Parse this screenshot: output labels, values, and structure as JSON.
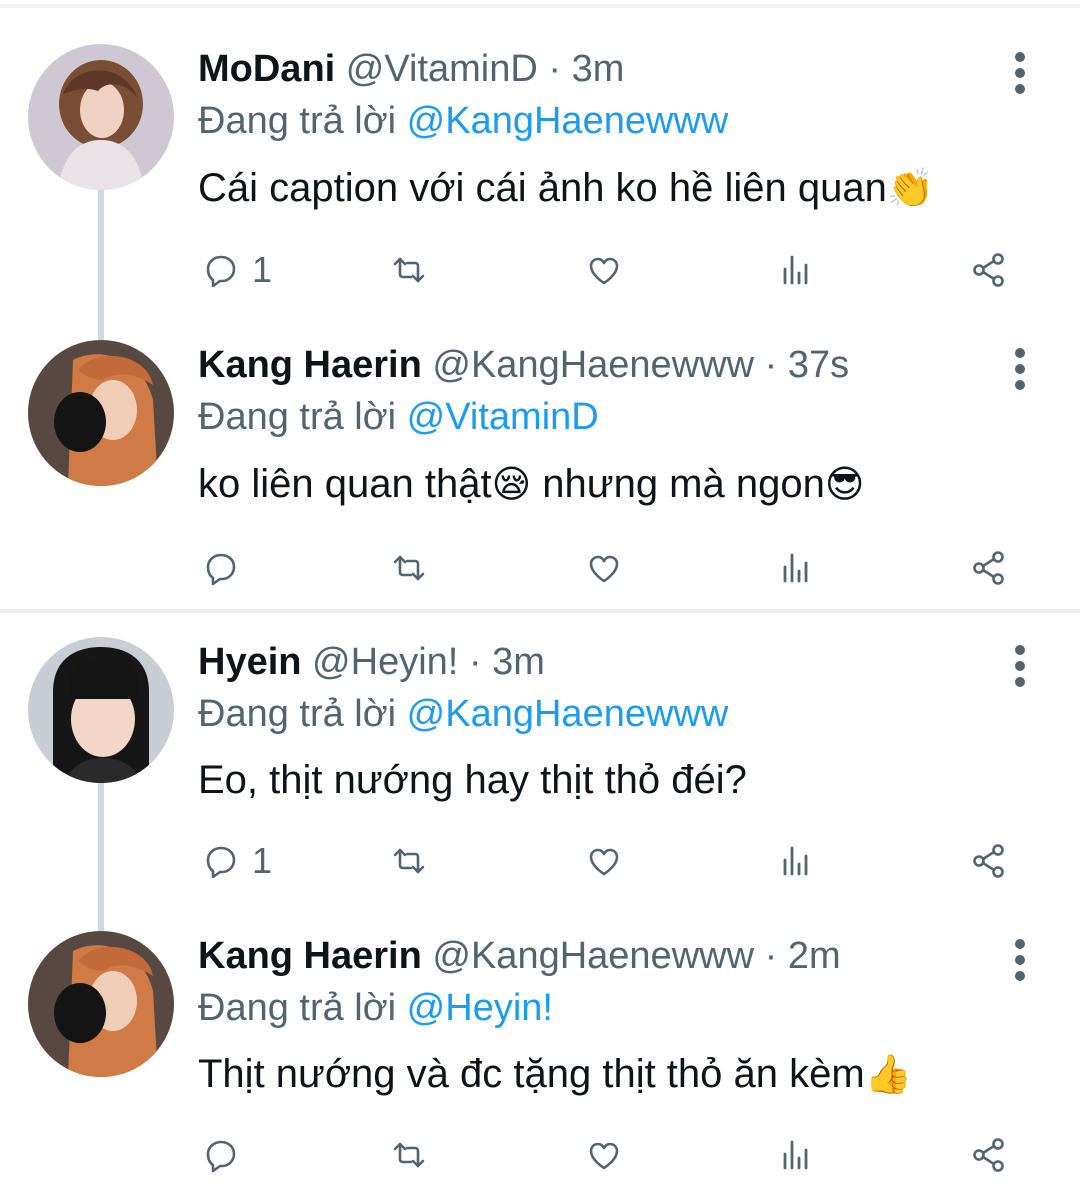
{
  "colors": {
    "link": "#1d9bf0",
    "secondary": "#536471",
    "primary": "#0f1419",
    "thread_line": "#cfd9de"
  },
  "icons": {
    "reply": "speech-bubble-icon",
    "retweet": "retweet-icon",
    "like": "heart-icon",
    "analytics": "bar-chart-icon",
    "share": "share-icon",
    "more": "more-vertical-icon"
  },
  "tweets": [
    {
      "name": "MoDani",
      "handle": "@VitaminD",
      "sep": "·",
      "time": "3m",
      "replying_prefix": "Đang trả lời",
      "replying_to": "@KangHaenewww",
      "text": "Cái caption với cái ảnh ko hề liên quan",
      "emoji": "👏",
      "reply_count": "1"
    },
    {
      "name": "Kang Haerin",
      "handle": "@KangHaenewww",
      "sep": "·",
      "time": "37s",
      "replying_prefix": "Đang trả lời",
      "replying_to": "@VitaminD",
      "text_a": "ko liên quan thật",
      "emoji_a": "😪",
      "text_b": " nhưng mà ngon",
      "emoji_b": "😎",
      "reply_count": ""
    },
    {
      "name": "Hyein",
      "handle": "@Heyin!",
      "sep": "·",
      "time": "3m",
      "replying_prefix": "Đang trả lời",
      "replying_to": "@KangHaenewww",
      "text": "Eo, thịt nướng hay thịt thỏ đéi?",
      "reply_count": "1"
    },
    {
      "name": "Kang Haerin",
      "handle": "@KangHaenewww",
      "sep": "·",
      "time": "2m",
      "replying_prefix": "Đang trả lời",
      "replying_to": "@Heyin!",
      "text": "Thịt nướng và đc tặng thịt thỏ ăn kèm",
      "emoji": "👍",
      "reply_count": ""
    }
  ]
}
